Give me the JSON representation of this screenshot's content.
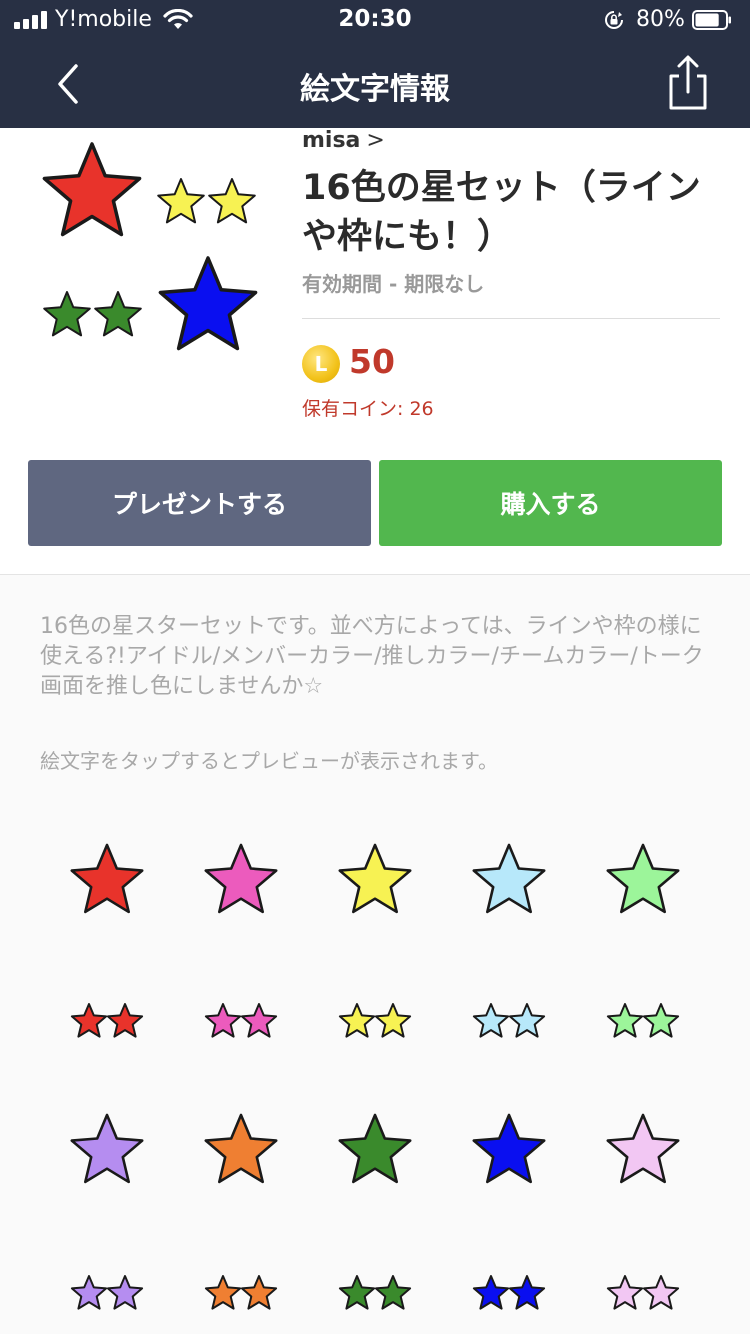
{
  "status_bar": {
    "carrier": "Y!mobile",
    "time": "20:30",
    "battery": "80%",
    "battery_level": 0.8,
    "icons": [
      "signal-icon",
      "wifi-icon",
      "rotation-lock-icon",
      "battery-icon"
    ]
  },
  "nav": {
    "title": "絵文字情報",
    "back_icon": "chevron-left-icon",
    "share_icon": "share-icon"
  },
  "product": {
    "author": "misa",
    "author_chevron": ">",
    "title": "16色の星セット（ラインや枠にも！）",
    "validity": "有効期間 - 期限なし",
    "coin_letter": "L",
    "price": "50",
    "owned_coins": "保有コイン: 26",
    "hero_colors": [
      "#e8332b",
      "#f7f253",
      "#3a8a2c",
      "#0a0ff0"
    ]
  },
  "buttons": {
    "present": "プレゼントする",
    "buy": "購入する"
  },
  "colors": {
    "accent_buy": "#52b74e",
    "button_present": "#5f6780",
    "price": "#c0392b",
    "header_bg": "#283044"
  },
  "description": "16色の星スターセットです。並べ方によっては、ラインや枠の様に使える?!アイドル/メンバーカラー/推しカラー/チームカラー/トーク画面を推し色にしませんか☆",
  "hint": "絵文字をタップするとプレビューが表示されます。",
  "emoji_grid": {
    "rows": [
      {
        "kind": "single",
        "colors": [
          "#e8332b",
          "#ec5bbd",
          "#f7f253",
          "#b7e8fa",
          "#9cf59a"
        ]
      },
      {
        "kind": "double",
        "colors": [
          "#e8332b",
          "#ec5bbd",
          "#f7f253",
          "#b7e8fa",
          "#9cf59a"
        ]
      },
      {
        "kind": "single",
        "colors": [
          "#b58df0",
          "#ef7f32",
          "#3a8a2c",
          "#0a0ff0",
          "#f2c7f3"
        ]
      },
      {
        "kind": "double",
        "colors": [
          "#b58df0",
          "#ef7f32",
          "#3a8a2c",
          "#0a0ff0",
          "#f2c7f3"
        ]
      }
    ]
  }
}
